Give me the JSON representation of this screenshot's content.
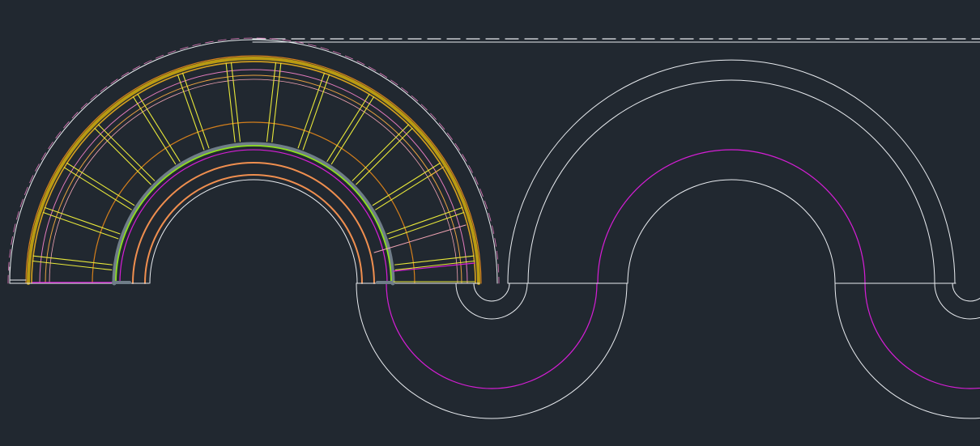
{
  "drawing": {
    "background": "#212830",
    "colors": {
      "outline": "#e9ecf0",
      "magenta": "#d61ed6",
      "orange": "#e6a040",
      "dark_orange": "#d47f1c",
      "coral": "#f08f4f",
      "yellow": "#e8e83a",
      "olive_gold": "#b99a12",
      "gold": "#d7a21f",
      "pink": "#e27bbd",
      "lime": "#8fe01e",
      "steel": "#6f7d88",
      "light_pink": "#f3a5b5"
    },
    "rib_count": 14,
    "dashed_centerline": true,
    "labels": []
  }
}
